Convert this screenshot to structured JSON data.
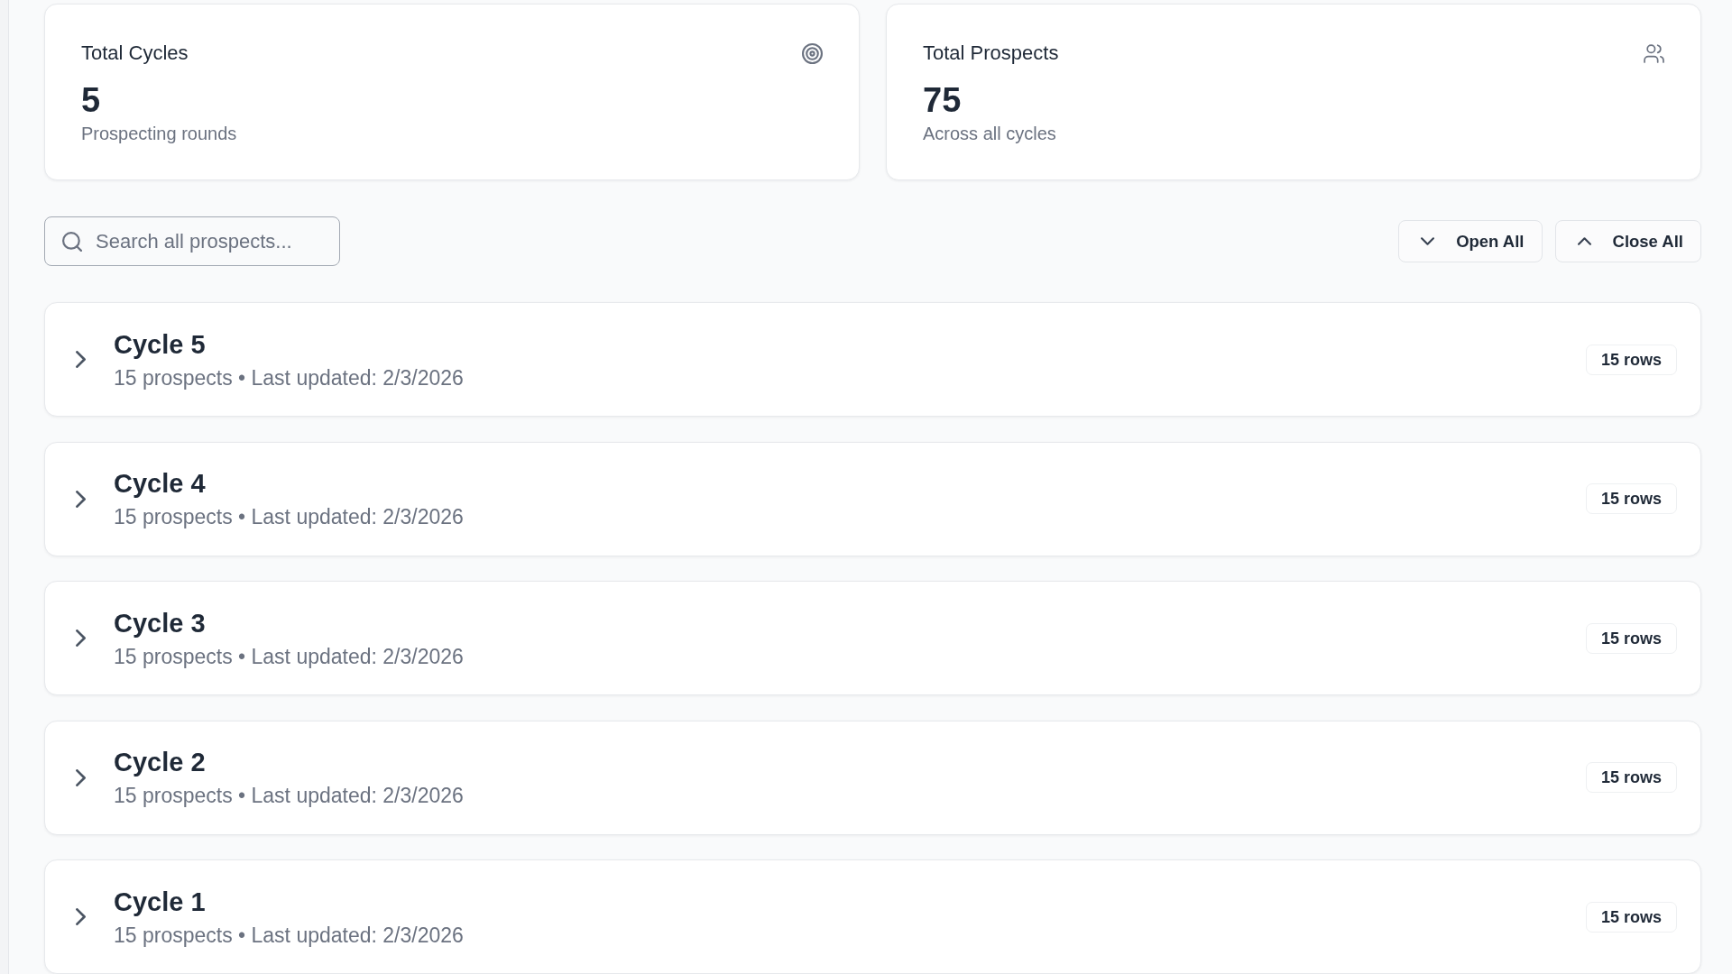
{
  "stats": [
    {
      "title": "Total Cycles",
      "value": "5",
      "caption": "Prospecting rounds"
    },
    {
      "title": "Total Prospects",
      "value": "75",
      "caption": "Across all cycles"
    }
  ],
  "search": {
    "placeholder": "Search all prospects..."
  },
  "actions": [
    {
      "label": "Open All"
    },
    {
      "label": "Close All"
    }
  ],
  "cycles": [
    {
      "title": "Cycle 5",
      "meta": "15 prospects • Last updated: 2/3/2026",
      "badge": "15 rows",
      "expanded": false
    },
    {
      "title": "Cycle 4",
      "meta": "15 prospects • Last updated: 2/3/2026",
      "badge": "15 rows",
      "expanded": false
    },
    {
      "title": "Cycle 3",
      "meta": "15 prospects • Last updated: 2/3/2026",
      "badge": "15 rows",
      "expanded": false
    },
    {
      "title": "Cycle 2",
      "meta": "15 prospects • Last updated: 2/3/2026",
      "badge": "15 rows",
      "expanded": false
    },
    {
      "title": "Cycle 1",
      "meta": "15 prospects • Last updated: 2/3/2026",
      "badge": "15 rows",
      "expanded": false
    }
  ]
}
